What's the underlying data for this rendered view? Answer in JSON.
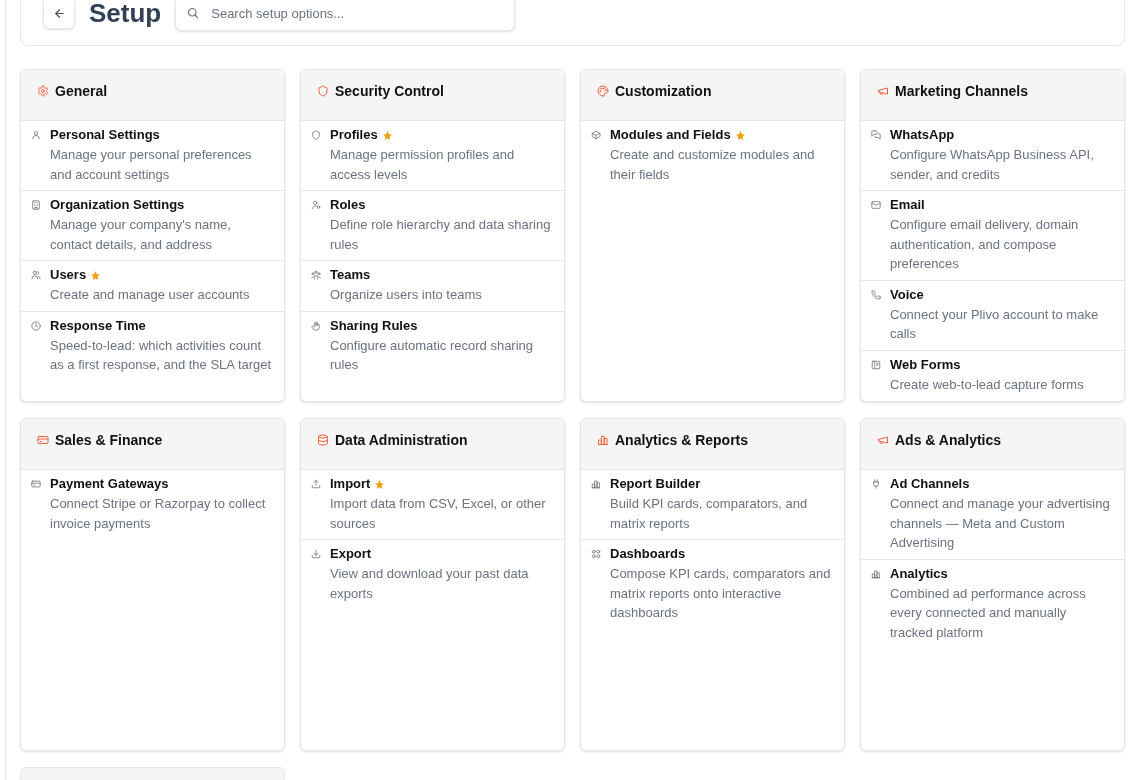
{
  "header": {
    "title": "Setup",
    "search": {
      "placeholder": "Search setup options..."
    }
  },
  "sections": [
    {
      "kind": "card",
      "title": "General",
      "items": [
        {
          "name": "Personal Settings",
          "description": "Manage your personal preferences and account settings",
          "starred": false
        },
        {
          "name": "Organization Settings",
          "description": "Manage your company's name, contact details, and address",
          "starred": false
        },
        {
          "name": "Users",
          "description": "Create and manage user accounts",
          "starred": true
        },
        {
          "name": "Response Time",
          "description": "Speed-to-lead: which activities count as a first response, and the SLA target",
          "starred": false
        }
      ]
    },
    {
      "kind": "card",
      "title": "Security Control",
      "items": [
        {
          "name": "Profiles",
          "description": "Manage permission profiles and access levels",
          "starred": true
        },
        {
          "name": "Roles",
          "description": "Define role hierarchy and data sharing rules",
          "starred": false
        },
        {
          "name": "Teams",
          "description": "Organize users into teams",
          "starred": false
        },
        {
          "name": "Sharing Rules",
          "description": "Configure automatic record sharing rules",
          "starred": false
        }
      ]
    },
    {
      "kind": "card",
      "title": "Customization",
      "items": [
        {
          "name": "Modules and Fields",
          "description": "Create and customize modules and their fields",
          "starred": true
        }
      ]
    },
    {
      "kind": "card",
      "title": "Marketing Channels",
      "items": [
        {
          "name": "WhatsApp",
          "description": "Configure WhatsApp Business API, sender, and credits",
          "starred": false
        },
        {
          "name": "Email",
          "description": "Configure email delivery, domain authentication, and compose preferences",
          "starred": false
        },
        {
          "name": "Voice",
          "description": "Connect your Plivo account to make calls",
          "starred": false
        },
        {
          "name": "Web Forms",
          "description": "Create web-to-lead capture forms",
          "starred": false
        }
      ]
    },
    {
      "kind": "card",
      "title": "Sales & Finance",
      "items": [
        {
          "name": "Payment Gateways",
          "description": "Connect Stripe or Razorpay to collect invoice payments",
          "starred": false
        }
      ]
    },
    {
      "kind": "card",
      "title": "Data Administration",
      "items": [
        {
          "name": "Import",
          "description": "Import data from CSV, Excel, or other sources",
          "starred": true
        },
        {
          "name": "Export",
          "description": "View and download your past data exports",
          "starred": false
        }
      ]
    },
    {
      "kind": "card",
      "title": "Analytics & Reports",
      "items": [
        {
          "name": "Report Builder",
          "description": "Build KPI cards, comparators, and matrix reports",
          "starred": false
        },
        {
          "name": "Dashboards",
          "description": "Compose KPI cards, comparators and matrix reports onto interactive dashboards",
          "starred": false
        }
      ]
    },
    {
      "kind": "card",
      "title": "Ads & Analytics",
      "items": [
        {
          "name": "Ad Channels",
          "description": "Connect and manage your advertising channels — Meta and Custom Advertising",
          "starred": false
        },
        {
          "name": "Analytics",
          "description": "Combined ad performance across every connected and manually tracked platform",
          "starred": false
        }
      ]
    },
    {
      "kind": "clipped"
    }
  ]
}
